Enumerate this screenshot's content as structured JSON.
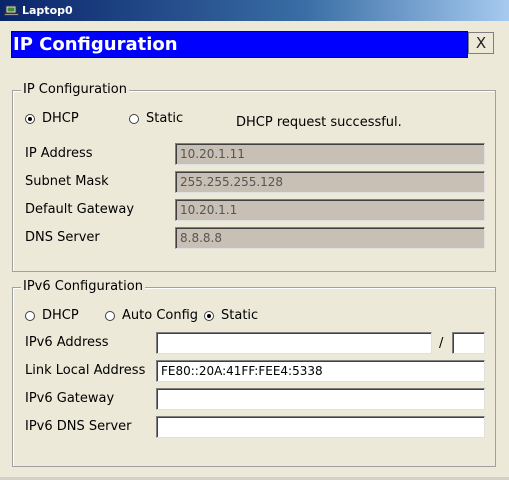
{
  "window": {
    "title": "Laptop0",
    "icon": "laptop-app-icon"
  },
  "header": {
    "title": "IP Configuration",
    "close_label": "X"
  },
  "ipv4": {
    "legend": "IP Configuration",
    "dhcp_label": "DHCP",
    "static_label": "Static",
    "selected_mode": "DHCP",
    "status": "DHCP request successful.",
    "ip_label": "IP Address",
    "ip_value": "10.20.1.11",
    "mask_label": "Subnet Mask",
    "mask_value": "255.255.255.128",
    "gateway_label": "Default Gateway",
    "gateway_value": "10.20.1.1",
    "dns_label": "DNS Server",
    "dns_value": "8.8.8.8"
  },
  "ipv6": {
    "legend": "IPv6 Configuration",
    "dhcp_label": "DHCP",
    "auto_label": "Auto Config",
    "static_label": "Static",
    "selected_mode": "Static",
    "address_label": "IPv6 Address",
    "address_value": "",
    "prefix_separator": "/",
    "prefix_value": "",
    "link_local_label": "Link Local Address",
    "link_local_value": "FE80::20A:41FF:FEE4:5338",
    "gateway_label": "IPv6 Gateway",
    "gateway_value": "",
    "dns_label": "IPv6 DNS Server",
    "dns_value": ""
  }
}
